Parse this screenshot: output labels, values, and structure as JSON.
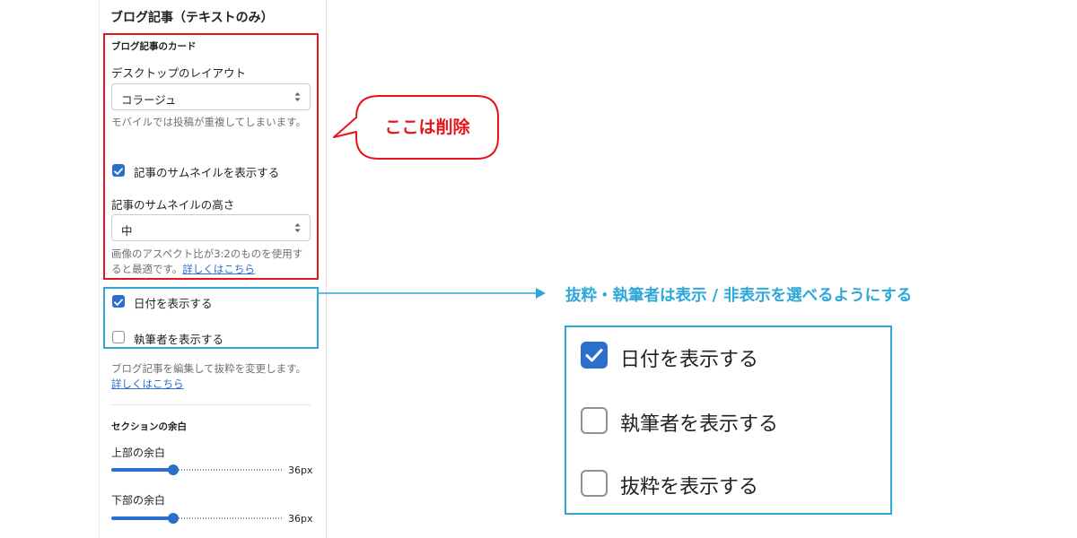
{
  "settings": {
    "title": "ブログ記事（テキストのみ）",
    "card_section": {
      "title": "ブログ記事のカード",
      "desktop_layout_label": "デスクトップのレイアウト",
      "desktop_layout_value": "コラージュ",
      "desktop_layout_help": "モバイルでは投稿が重複してしまいます。",
      "show_thumbnail_label": "記事のサムネイルを表示する",
      "show_thumbnail_checked": true,
      "thumbnail_height_label": "記事のサムネイルの高さ",
      "thumbnail_height_value": "中",
      "thumbnail_height_help": "画像のアスペクト比が3:2のものを使用すると最適です。",
      "thumbnail_height_link": "詳しくはこちら"
    },
    "show_date_label": "日付を表示する",
    "show_date_checked": true,
    "show_author_label": "執筆者を表示する",
    "show_author_checked": false,
    "excerpt_help": "ブログ記事を編集して抜粋を変更します。",
    "excerpt_link": "詳しくはこちら",
    "padding": {
      "title": "セクションの余白",
      "top_label": "上部の余白",
      "top_value": "36px",
      "top_fraction": 0.36,
      "bottom_label": "下部の余白",
      "bottom_value": "36px",
      "bottom_fraction": 0.36
    }
  },
  "annotations": {
    "delete_note": "ここは削除",
    "headline": "抜粋・執筆者は表示 / 非表示を選べるようにする",
    "zoom_items": [
      {
        "label": "日付を表示する",
        "checked": true
      },
      {
        "label": "執筆者を表示する",
        "checked": false
      },
      {
        "label": "抜粋を表示する",
        "checked": false
      }
    ],
    "colors": {
      "red": "#e8141b",
      "blue": "#2ea7d9",
      "accent": "#2c6ecb"
    }
  }
}
